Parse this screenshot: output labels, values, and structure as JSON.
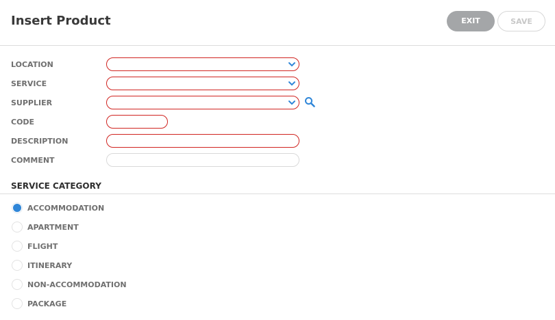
{
  "header": {
    "title": "Insert Product",
    "exit_label": "EXIT",
    "save_label": "SAVE"
  },
  "form": {
    "location": {
      "label": "LOCATION",
      "value": ""
    },
    "service": {
      "label": "SERVICE",
      "value": ""
    },
    "supplier": {
      "label": "SUPPLIER",
      "value": ""
    },
    "code": {
      "label": "CODE",
      "value": ""
    },
    "description": {
      "label": "DESCRIPTION",
      "value": ""
    },
    "comment": {
      "label": "COMMENT",
      "value": ""
    }
  },
  "service_category": {
    "title": "SERVICE CATEGORY",
    "selected": "ACCOMMODATION",
    "options": [
      "ACCOMMODATION",
      "APARTMENT",
      "FLIGHT",
      "ITINERARY",
      "NON-ACCOMMODATION",
      "PACKAGE"
    ]
  },
  "colors": {
    "accent": "#2f86d8",
    "error": "#d0231f",
    "button_gray": "#a4a6a8"
  }
}
